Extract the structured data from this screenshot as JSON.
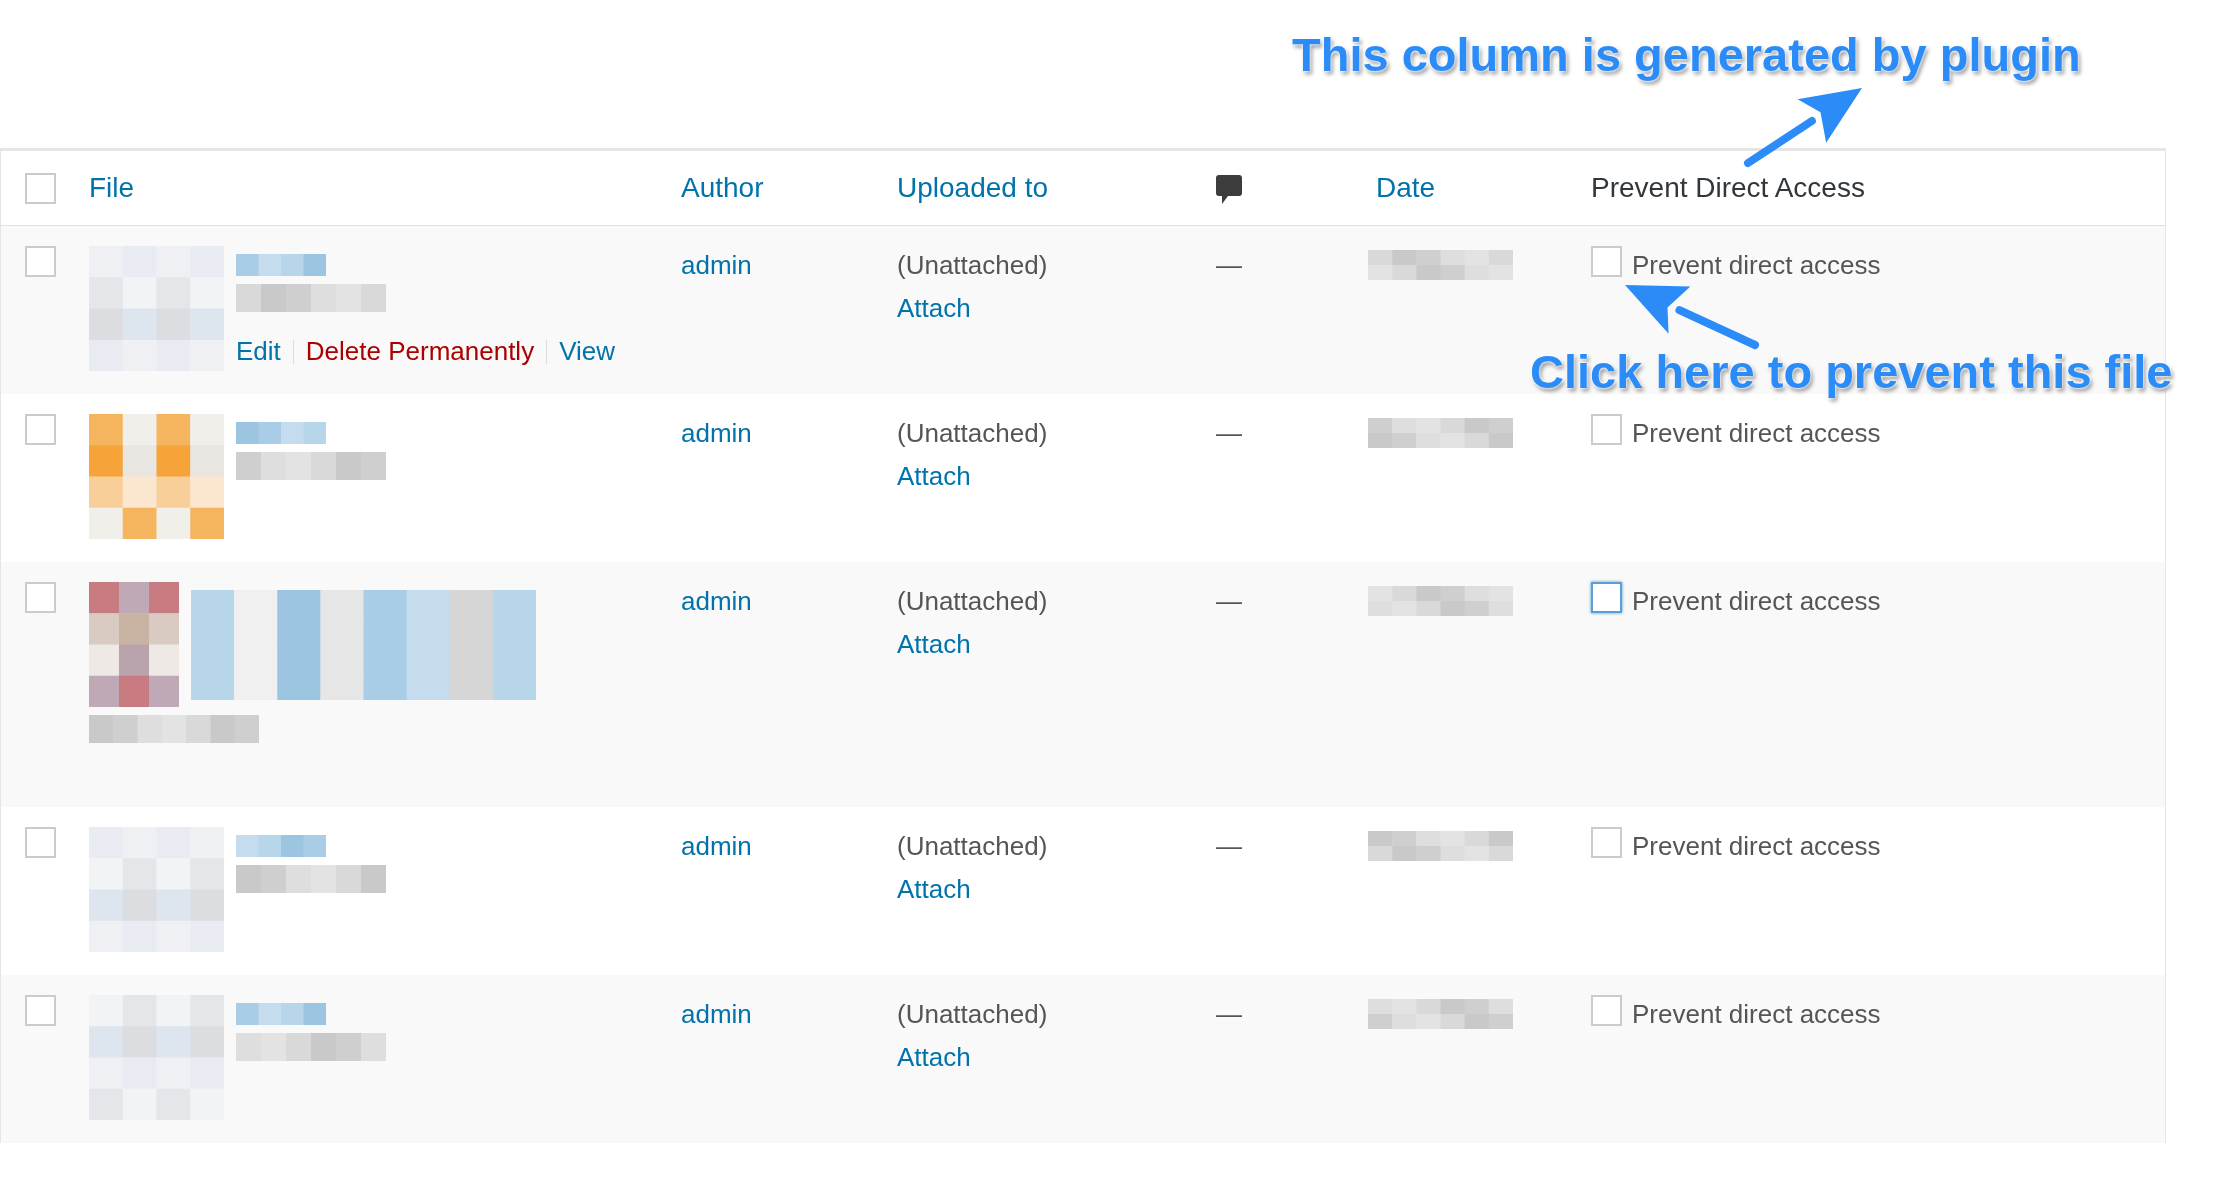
{
  "annotations": [
    {
      "text": "This column is generated by plugin"
    },
    {
      "text": "Click here to prevent this file"
    }
  ],
  "table": {
    "select_all": {
      "checked": false
    },
    "columns": [
      {
        "label": "File",
        "kind": "link"
      },
      {
        "label": "Author",
        "kind": "link"
      },
      {
        "label": "Uploaded to",
        "kind": "link"
      },
      {
        "kind": "comment"
      },
      {
        "label": "Date",
        "kind": "link"
      },
      {
        "label": "Prevent Direct Access",
        "kind": "plain"
      }
    ],
    "rows": [
      {
        "checked": false,
        "actions": [
          {
            "label": "Edit",
            "kind": "link"
          },
          {
            "label": "Delete Permanently",
            "kind": "delete"
          },
          {
            "label": "View",
            "kind": "link"
          }
        ],
        "author": "admin",
        "uploaded_to": "(Unattached)",
        "attach": "Attach",
        "comments": "—",
        "pda": {
          "label": "Prevent direct access",
          "checked": false,
          "focused": false
        }
      },
      {
        "checked": false,
        "author": "admin",
        "uploaded_to": "(Unattached)",
        "attach": "Attach",
        "comments": "—",
        "pda": {
          "label": "Prevent direct access",
          "checked": false,
          "focused": false
        }
      },
      {
        "checked": false,
        "author": "admin",
        "uploaded_to": "(Unattached)",
        "attach": "Attach",
        "comments": "—",
        "pda": {
          "label": "Prevent direct access",
          "checked": false,
          "focused": true
        }
      },
      {
        "checked": false,
        "author": "admin",
        "uploaded_to": "(Unattached)",
        "attach": "Attach",
        "comments": "—",
        "pda": {
          "label": "Prevent direct access",
          "checked": false,
          "focused": false
        }
      },
      {
        "checked": false,
        "author": "admin",
        "uploaded_to": "(Unattached)",
        "attach": "Attach",
        "comments": "—",
        "pda": {
          "label": "Prevent direct access",
          "checked": false,
          "focused": false
        }
      }
    ]
  }
}
